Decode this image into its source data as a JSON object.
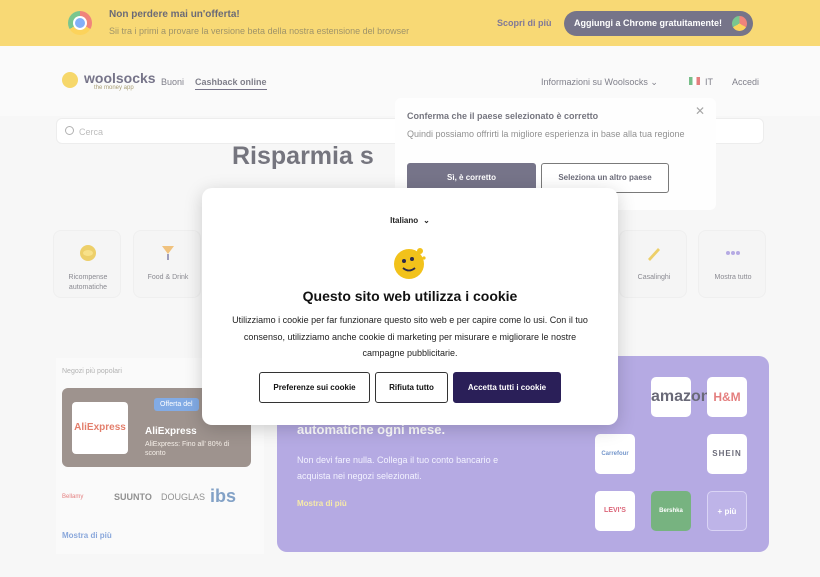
{
  "promo": {
    "title": "Non perdere mai un'offerta!",
    "subtitle": "Sii tra i primi a provare la versione beta della nostra estensione del browser",
    "discover_label": "Scopri di più",
    "add_button_label": "Aggiungi a Chrome gratuitamente!"
  },
  "nav": {
    "logo_text": "woolsocks",
    "logo_tagline": "the money app",
    "links": [
      "Buoni",
      "Cashback online"
    ],
    "info_label": "Informazioni su Woolsocks",
    "lang_code": "IT",
    "login_label": "Accedi"
  },
  "search": {
    "placeholder": "Cerca"
  },
  "hero": {
    "title": "Risparmia s"
  },
  "categories": [
    {
      "label": "Ricompense automatiche",
      "icon": "coin-icon"
    },
    {
      "label": "Food & Drink",
      "icon": "drink-icon"
    },
    {
      "label": "Casalinghi",
      "icon": "brush-icon"
    },
    {
      "label": "Mostra tutto",
      "icon": "dots-icon"
    }
  ],
  "merchants": {
    "heading": "Negozi più popolari",
    "featured": {
      "logo": "AliExpress",
      "badge": "Offerta del",
      "name": "AliExpress",
      "description": "AliExpress: Fino all' 80% di sconto"
    },
    "brands": [
      "Bellamy",
      "SUUNTO",
      "DOUGLAS",
      "ibs"
    ],
    "show_more": "Mostra di più"
  },
  "rewards": {
    "heading": "automatiche ogni mese.",
    "text": "Non devi fare nulla. Collega il tuo conto bancario e acquista nei negozi selezionati.",
    "link": "Mostra di più",
    "brands": [
      "amazon",
      "H&M",
      "Carrefour",
      "SHEIN",
      "LEVI'S",
      "Bershka",
      "+ più"
    ]
  },
  "country_popup": {
    "title": "Conferma che il paese selezionato è corretto",
    "text": "Quindi possiamo offrirti la migliore esperienza in base alla tua regione",
    "confirm_label": "Sì, è corretto",
    "other_label": "Seleziona un altro paese"
  },
  "cookie_modal": {
    "language": "Italiano",
    "title": "Questo sito web utilizza i cookie",
    "body": "Utilizziamo i cookie per far funzionare questo sito web e per capire come lo usi. Con il tuo consenso, utilizziamo anche cookie di marketing per misurare e migliorare le nostre campagne pubblicitarie.",
    "preferences_label": "Preferenze sui cookie",
    "reject_label": "Rifiuta tutto",
    "accept_label": "Accetta tutti i cookie"
  },
  "colors": {
    "brand_yellow": "#f5c52b",
    "brand_navy": "#2d2a4a",
    "accept_button": "#2a1f58",
    "rewards_purple": "#8e7dd4"
  }
}
